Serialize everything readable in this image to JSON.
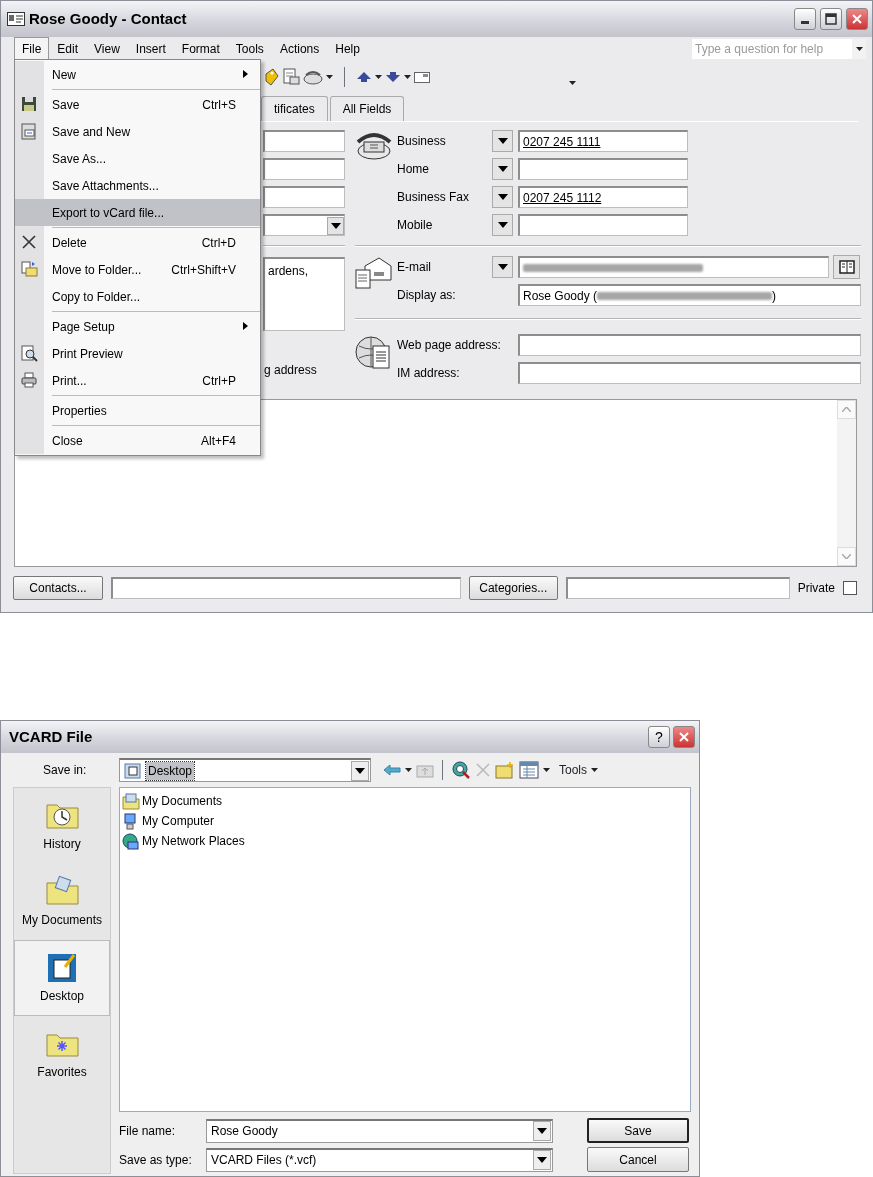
{
  "contact_window": {
    "title": "Rose Goody - Contact",
    "menu_bar": [
      {
        "label": "File",
        "selected": true
      },
      {
        "label": "Edit",
        "selected": false
      },
      {
        "label": "View",
        "selected": false
      },
      {
        "label": "Insert",
        "selected": false
      },
      {
        "label": "Format",
        "selected": false
      },
      {
        "label": "Tools",
        "selected": false
      },
      {
        "label": "Actions",
        "selected": false
      },
      {
        "label": "Help",
        "selected": false
      }
    ],
    "help_box": {
      "placeholder": "Type a question for help"
    },
    "tabs": [
      {
        "label": "tificates",
        "selected": false
      },
      {
        "label": "All Fields",
        "selected": false
      }
    ],
    "address": {
      "text": "ardens,",
      "label": "g address"
    },
    "phones": [
      {
        "label": "Business",
        "value": "0207 245 1111"
      },
      {
        "label": "Home"
      },
      {
        "label": "Business Fax",
        "value": "0207 245 1112"
      },
      {
        "label": "Mobile"
      }
    ],
    "email": {
      "label": "E-mail",
      "obscured": true
    },
    "display_as": {
      "label": "Display as:",
      "prefix": "Rose Goody (",
      "suffix": ")",
      "obscured": true
    },
    "web": {
      "label": "Web page address:"
    },
    "im": {
      "label": "IM address:"
    },
    "bottom_bar": {
      "contacts_button": "Contacts...",
      "categories_button": "Categories...",
      "private_label": "Private",
      "private_checked": false
    },
    "file_menu": {
      "groups": [
        [
          {
            "label": "New",
            "submenu": true,
            "selected": false
          }
        ],
        [
          {
            "label": "Save",
            "shortcut": "Ctrl+S",
            "submenu": false,
            "selected": false
          },
          {
            "label": "Save and New",
            "submenu": false,
            "selected": false
          },
          {
            "label": "Save As...",
            "submenu": false,
            "selected": false
          },
          {
            "label": "Save Attachments...",
            "submenu": false,
            "selected": false
          },
          {
            "label": "Export to vCard file...",
            "submenu": false,
            "selected": true
          }
        ],
        [
          {
            "label": "Delete",
            "shortcut": "Ctrl+D",
            "submenu": false,
            "selected": false
          },
          {
            "label": "Move to Folder...",
            "shortcut": "Ctrl+Shift+V",
            "submenu": false,
            "selected": false
          },
          {
            "label": "Copy to Folder...",
            "submenu": false,
            "selected": false
          }
        ],
        [
          {
            "label": "Page Setup",
            "submenu": true,
            "selected": false
          },
          {
            "label": "Print Preview",
            "submenu": false,
            "selected": false
          },
          {
            "label": "Print...",
            "shortcut": "Ctrl+P",
            "submenu": false,
            "selected": false
          }
        ],
        [
          {
            "label": "Properties",
            "submenu": false,
            "selected": false
          }
        ],
        [
          {
            "label": "Close",
            "shortcut": "Alt+F4",
            "submenu": false,
            "selected": false
          }
        ]
      ]
    }
  },
  "dialog": {
    "title": "VCARD File",
    "help_button": "?",
    "save_in_label": "Save in:",
    "save_in_value": "Desktop",
    "tools_label": "Tools",
    "places": [
      {
        "label": "History",
        "selected": false
      },
      {
        "label": "My Documents",
        "selected": false
      },
      {
        "label": "Desktop",
        "selected": true
      },
      {
        "label": "Favorites",
        "selected": false
      }
    ],
    "files": [
      "My Documents",
      "My Computer",
      "My Network Places"
    ],
    "file_name_label": "File name:",
    "file_name": "Rose Goody",
    "type_label": "Save as type:",
    "type_value": "VCARD Files (*.vcf)",
    "save_button": "Save",
    "cancel_button": "Cancel"
  }
}
